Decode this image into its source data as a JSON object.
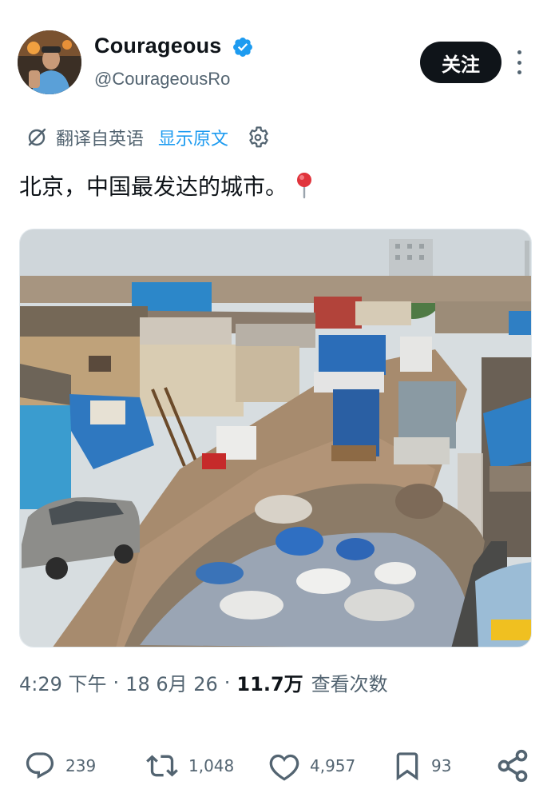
{
  "user": {
    "display_name": "Courageous",
    "handle": "@CourageousRo",
    "verified_icon": "verified-badge-icon",
    "avatar_icon": "avatar"
  },
  "header": {
    "follow_label": "关注",
    "more_icon": "more-vertical-icon"
  },
  "translation": {
    "icon": "translate-icon",
    "label": "翻译自英语",
    "show_original_label": "显示原文",
    "settings_icon": "gear-icon"
  },
  "tweet": {
    "text": "北京，中国最发达的城市。",
    "emoji_icon": "round-pushpin-icon",
    "media_alt": "street-photo"
  },
  "meta": {
    "time": "4:29 下午",
    "separator": "·",
    "date": "18 6月 26",
    "views_count": "11.7万",
    "views_label": "查看次数"
  },
  "actions": {
    "reply": {
      "icon": "reply-icon",
      "count": "239"
    },
    "retweet": {
      "icon": "retweet-icon",
      "count": "1,048"
    },
    "like": {
      "icon": "heart-icon",
      "count": "4,957"
    },
    "bookmark": {
      "icon": "bookmark-icon",
      "count": "93"
    },
    "share": {
      "icon": "share-icon"
    }
  },
  "colors": {
    "accent": "#1d9bf0",
    "text_primary": "#0f1419",
    "text_secondary": "#536471",
    "follow_bg": "#0f1419"
  }
}
